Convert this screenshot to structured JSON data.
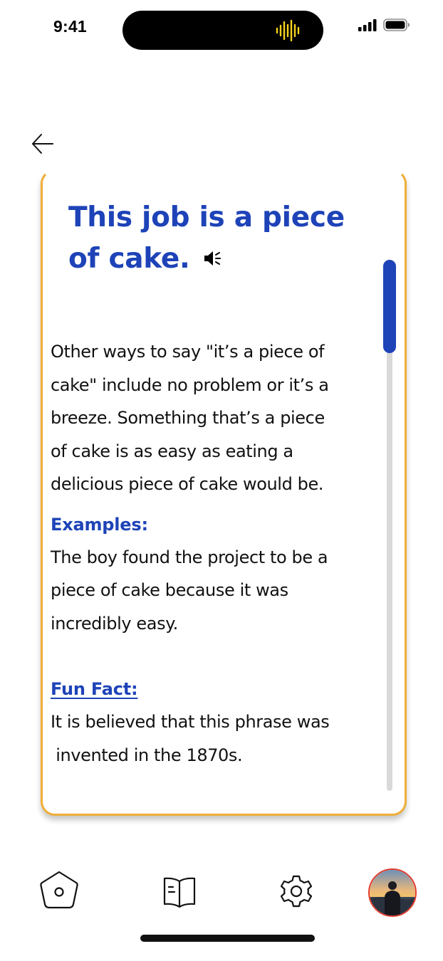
{
  "status_bar": {
    "time": "9:41",
    "icons": [
      "sound-wave-icon",
      "cellular-signal-icon",
      "battery-icon"
    ],
    "sound_wave_color": "#F4D21E"
  },
  "navigation": {
    "back_icon": "arrow-left-icon"
  },
  "card": {
    "border_color": "#EFAE38",
    "title_line1": "This job is a piece",
    "title_line2": "of cake.",
    "title_color": "#1E43B8",
    "speaker_icon": "speaker-icon",
    "description": [
      "Other ways to say \"it’s a piece of",
      "cake\" include no problem or it’s a",
      "breeze. Something that’s a piece",
      "of cake is as easy as eating a",
      "delicious piece of cake would be."
    ],
    "examples_heading": "Examples:",
    "examples_text": [
      "The boy found the project to be a",
      "piece of cake because it was",
      "incredibly easy."
    ],
    "fun_fact_heading": "Fun Fact:",
    "fun_fact_text": [
      "It is believed that this phrase was",
      " invented in the 1870s."
    ],
    "scroll_thumb_color": "#1E43B8"
  },
  "bottom_nav": {
    "items": [
      "home-icon",
      "book-icon",
      "settings-gear-icon",
      "profile-avatar"
    ],
    "avatar_border_color": "#E33D2F"
  }
}
